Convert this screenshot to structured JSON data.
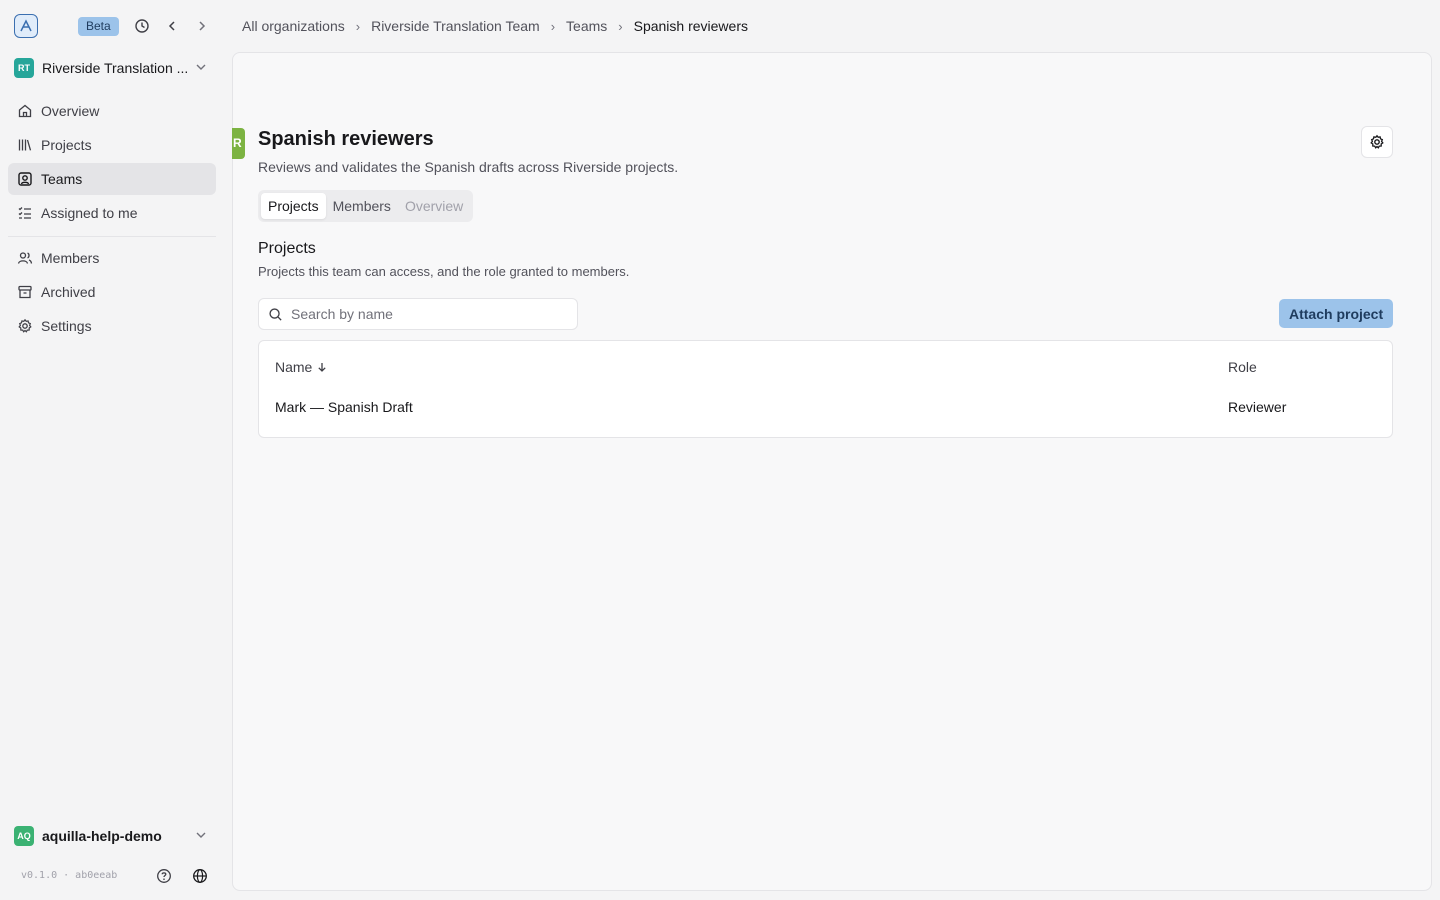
{
  "app": {
    "badge": "Beta",
    "org_name": "Riverside Translation ...",
    "org_initials": "RT",
    "org_color": "#26a69a"
  },
  "sidebar": {
    "primary": [
      {
        "label": "Overview",
        "icon": "home-icon"
      },
      {
        "label": "Projects",
        "icon": "library-icon"
      },
      {
        "label": "Teams",
        "icon": "contact-square-icon",
        "active": true
      },
      {
        "label": "Assigned to me",
        "icon": "list-checks-icon"
      }
    ],
    "secondary": [
      {
        "label": "Members",
        "icon": "users-icon"
      },
      {
        "label": "Archived",
        "icon": "archive-icon"
      },
      {
        "label": "Settings",
        "icon": "gear-icon"
      }
    ],
    "user": {
      "initials": "AQ",
      "name": "aquilla-help-demo",
      "color": "#3bb273"
    },
    "version": "v0.1.0 · ab0eeab"
  },
  "breadcrumb": [
    "All organizations",
    "Riverside Translation Team",
    "Teams",
    "Spanish reviewers"
  ],
  "team": {
    "marker": "R",
    "marker_color": "#7cb342",
    "title": "Spanish reviewers",
    "description": "Reviews and validates the Spanish drafts across Riverside projects."
  },
  "tabs": [
    {
      "label": "Projects",
      "state": "active"
    },
    {
      "label": "Members",
      "state": "normal"
    },
    {
      "label": "Overview",
      "state": "disabled"
    }
  ],
  "section": {
    "title": "Projects",
    "description": "Projects this team can access, and the role granted to members."
  },
  "search": {
    "placeholder": "Search by name",
    "value": ""
  },
  "attach_button": "Attach project",
  "table": {
    "columns": [
      "Name",
      "Role"
    ],
    "rows": [
      {
        "name": "Mark — Spanish Draft",
        "role": "Reviewer"
      }
    ]
  }
}
